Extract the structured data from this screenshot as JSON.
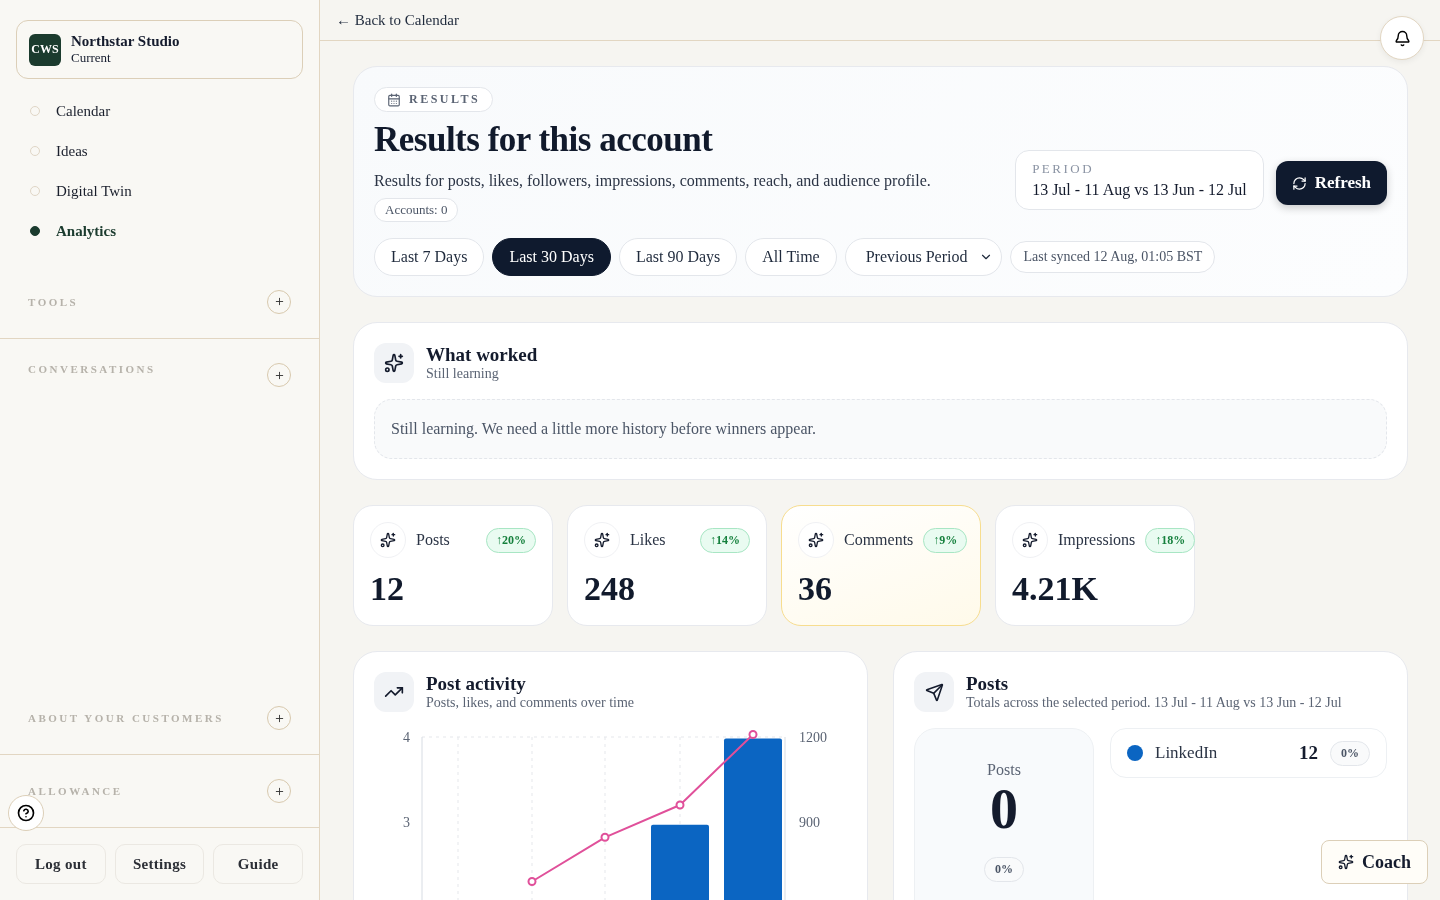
{
  "sidebar": {
    "account": {
      "avatar": "CWS",
      "name": "Northstar Studio",
      "status": "Current"
    },
    "nav": [
      {
        "label": "Calendar",
        "selected": false
      },
      {
        "label": "Ideas",
        "selected": false
      },
      {
        "label": "Digital Twin",
        "selected": false
      },
      {
        "label": "Analytics",
        "selected": true
      }
    ],
    "sections": [
      {
        "title": "TOOLS"
      },
      {
        "title": "CONVERSATIONS"
      },
      {
        "title": "ABOUT YOUR CUSTOMERS"
      },
      {
        "title": "ALLOWANCE"
      }
    ],
    "footer_buttons": [
      "Log out",
      "Settings",
      "Guide"
    ]
  },
  "topbar": {
    "back_link": "← Back to Calendar"
  },
  "header": {
    "badge": "RESULTS",
    "title": "Results for this account",
    "description": "Results for posts, likes, followers, impressions, comments, reach, and audience profile.",
    "accounts": "Accounts: 0",
    "period": {
      "label": "PERIOD",
      "value": "13 Jul - 11 Aug vs 13 Jun - 12 Jul"
    },
    "refresh": "Refresh",
    "ranges": [
      {
        "label": "Last 7 Days",
        "selected": false
      },
      {
        "label": "Last 30 Days",
        "selected": true
      },
      {
        "label": "Last 90 Days",
        "selected": false
      },
      {
        "label": "All Time",
        "selected": false
      }
    ],
    "compare": "Previous Period",
    "synced": "Last synced 12 Aug, 01:05 BST"
  },
  "what_worked": {
    "title": "What worked",
    "subtitle": "Still learning",
    "message": "Still learning. We need a little more history before winners appear."
  },
  "stats": [
    {
      "label": "Posts",
      "change": "↑20%",
      "value": "12",
      "highlighted": false
    },
    {
      "label": "Likes",
      "change": "↑14%",
      "value": "248",
      "highlighted": false
    },
    {
      "label": "Comments",
      "change": "↑9%",
      "value": "36",
      "highlighted": true
    },
    {
      "label": "Impressions",
      "change": "↑18%",
      "value": "4.21K",
      "highlighted": false
    }
  ],
  "activity": {
    "title": "Post activity",
    "subtitle": "Posts, likes, and comments over time",
    "left_axis_labels": [
      "4",
      "3"
    ],
    "right_axis_labels": [
      "1200",
      "900"
    ]
  },
  "posts": {
    "title": "Posts",
    "subtitle": "Totals across the selected period. 13 Jul - 11 Aug vs 13 Jun - 12 Jul",
    "total": {
      "label": "Posts",
      "value": "0",
      "change": "0%"
    },
    "platforms": [
      {
        "name": "LinkedIn",
        "color": "#0b65c2",
        "value": "12",
        "change": "0%"
      }
    ]
  },
  "coach": "Coach"
}
